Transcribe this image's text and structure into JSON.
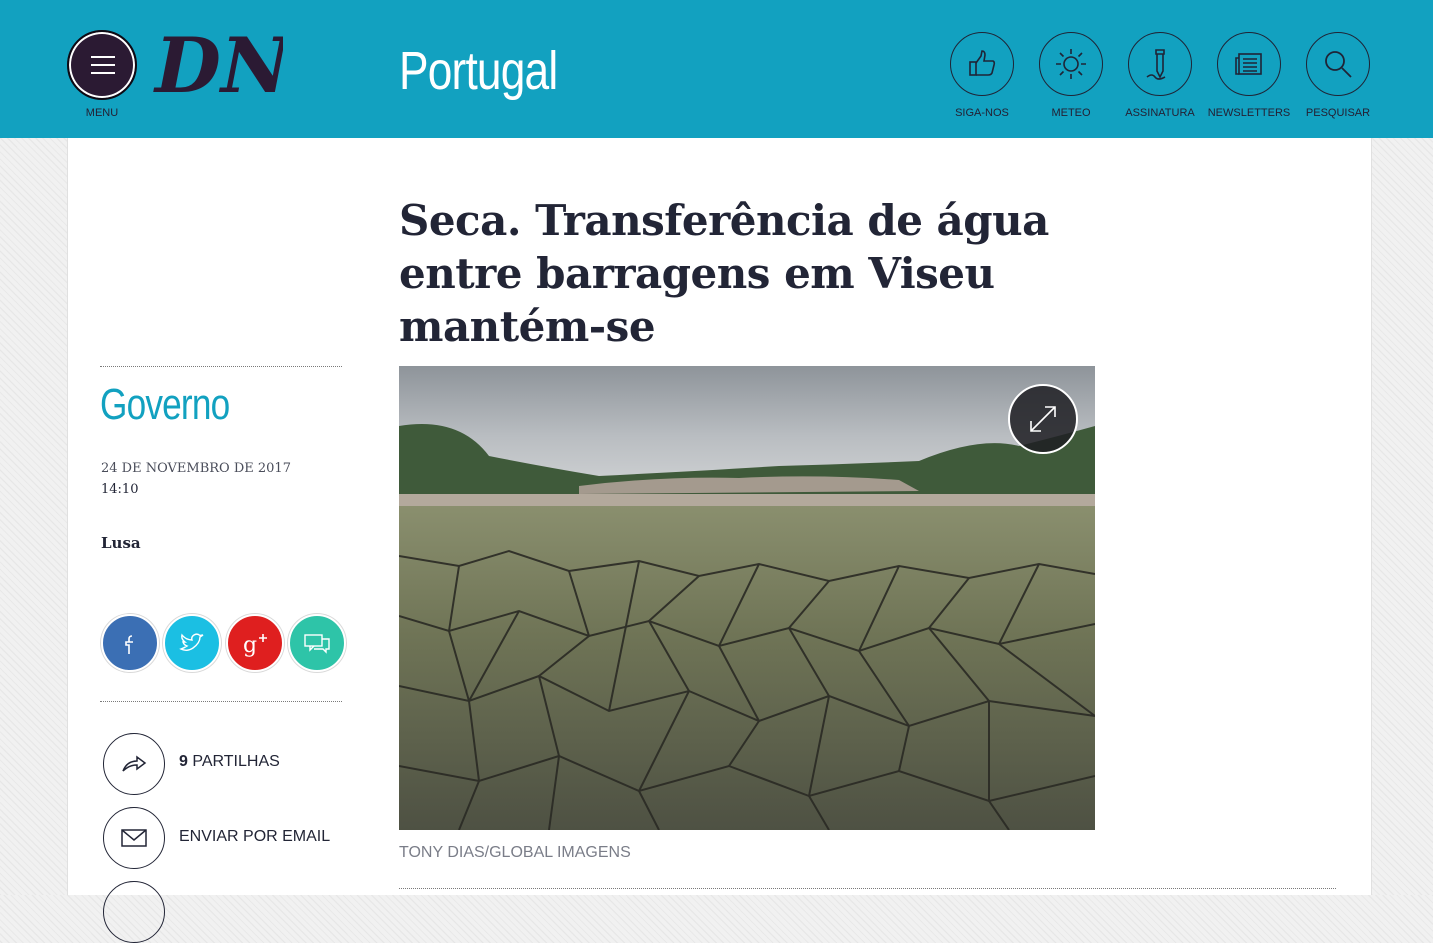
{
  "header": {
    "menu_label": "MENU",
    "logo_text": "DN",
    "section_title": "Portugal",
    "buttons": [
      {
        "label": "SIGA-NOS",
        "icon": "thumbs-up-icon"
      },
      {
        "label": "METEO",
        "icon": "sun-icon"
      },
      {
        "label": "ASSINATURA",
        "icon": "pen-icon"
      },
      {
        "label": "NEWSLETTERS",
        "icon": "newspaper-icon"
      },
      {
        "label": "PESQUISAR",
        "icon": "search-icon"
      }
    ],
    "colors": {
      "bar": "#12a1c0",
      "menu_button": "#2b1a33",
      "dark": "#222536"
    }
  },
  "article": {
    "headline": "Seca. Transferência de água entre barragens em Viseu mantém-se",
    "category": "Governo",
    "date": "24 DE NOVEMBRO DE 2017",
    "time": "14:10",
    "author": "Lusa",
    "photo_caption": "TONY DIAS/GLOBAL IMAGENS",
    "category_color": "#12a1c0"
  },
  "share": {
    "buttons": [
      {
        "name": "facebook",
        "icon": "facebook-icon",
        "color": "#3b6fb4"
      },
      {
        "name": "twitter",
        "icon": "twitter-icon",
        "color": "#1bbfe3"
      },
      {
        "name": "google-plus",
        "icon": "google-plus-icon",
        "color": "#df1f1f"
      },
      {
        "name": "comments",
        "icon": "comments-icon",
        "color": "#2ec4a8"
      }
    ],
    "shares_count": "9",
    "shares_label": "PARTILHAS",
    "email_label": "ENVIAR POR EMAIL"
  }
}
